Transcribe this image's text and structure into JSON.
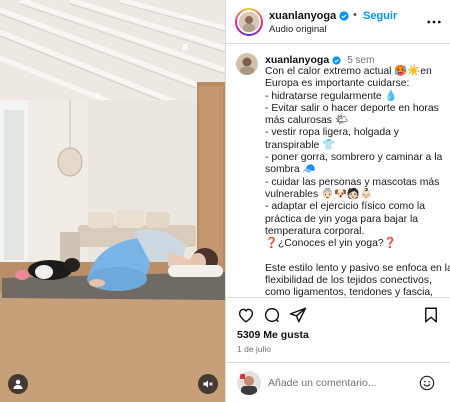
{
  "post": {
    "username": "xuanlanyoga",
    "follow_label": "Seguir",
    "audio_label": "Audio original",
    "time_ago": "5 sem",
    "caption_lines": [
      "Con el calor extremo actual 🥵☀️en",
      "Europa es importante cuidarse:",
      "- hidratarse regularmente 💧",
      "- Evitar salir o hacer deporte en horas",
      "más calurosas 🌤",
      "- vestir ropa ligera, holgada y",
      "transpirable 👕",
      "- poner gorra, sombrero y caminar a la",
      "sombra 🧢",
      "- cuidar las personas y mascotas más",
      "vulnerables 👵🏻🐶🧑🏻👶🏻",
      "- adaptar el ejercicio físico como la",
      "práctica de yin yoga para bajar la",
      "temperatura corporal.",
      "❓¿Conoces el yin yoga?❓",
      "",
      "Este estilo lento y pasivo se enfoca en la",
      "flexibilidad de los tejidos conectivos,",
      "como ligamentos, tendones y fascia,"
    ],
    "likes_label": "5309 Me gusta",
    "date_label": "1 de julio"
  },
  "comment": {
    "placeholder": "Añade un comentario..."
  },
  "icons": {
    "more": "more-horizontal-icon",
    "like": "heart-icon",
    "comment": "comment-icon",
    "share": "send-icon",
    "save": "bookmark-icon",
    "emoji": "emoji-icon",
    "user_tag": "user-tag-icon",
    "mute": "speaker-muted-icon",
    "verified": "verified-badge-icon"
  },
  "colors": {
    "accent": "#0095f6",
    "border": "#dbdbdb",
    "muted_text": "#737373"
  }
}
